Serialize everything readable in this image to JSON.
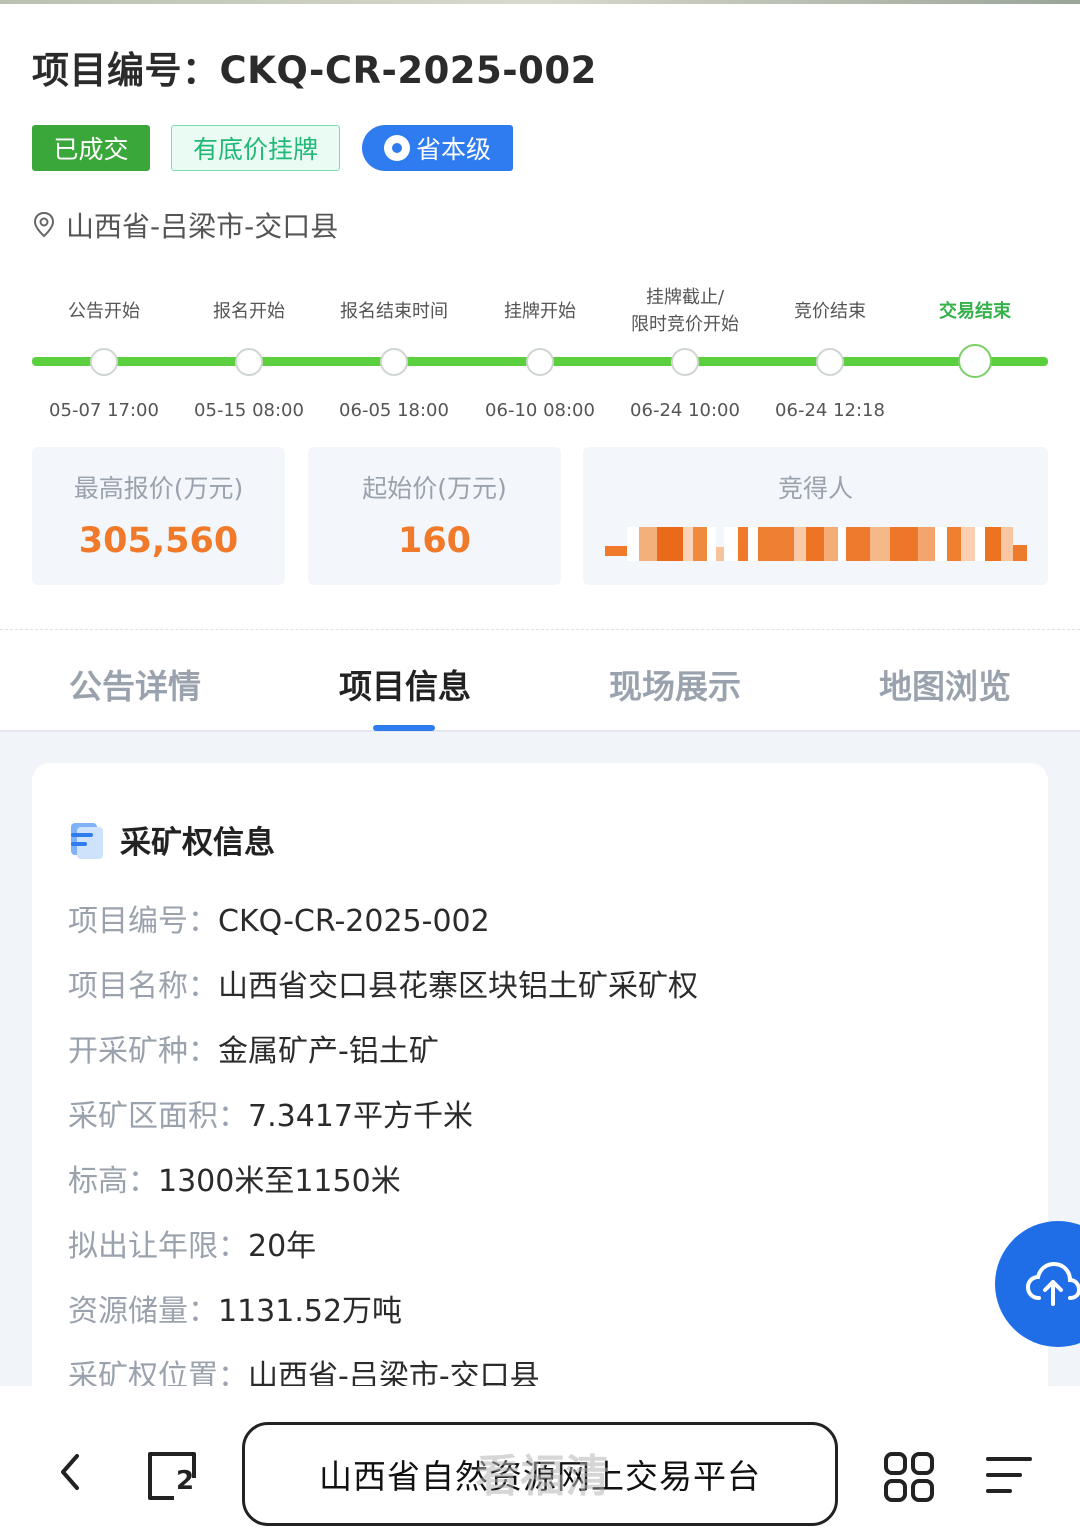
{
  "header": {
    "title_prefix": "项目编号：",
    "project_code": "CKQ-CR-2025-002",
    "tags": {
      "status": "已成交",
      "listing_type": "有底价挂牌",
      "level": "省本级"
    },
    "location": "山西省-吕梁市-交口县"
  },
  "timeline": {
    "steps": [
      {
        "label": "公告开始",
        "date": "05-07 17:00"
      },
      {
        "label": "报名开始",
        "date": "05-15 08:00"
      },
      {
        "label": "报名结束时间",
        "date": "06-05 18:00"
      },
      {
        "label": "挂牌开始",
        "date": "06-10 08:00"
      },
      {
        "label": "挂牌截止/",
        "label2": "限时竞价开始",
        "date": "06-24 10:00"
      },
      {
        "label": "竞价结束",
        "date": "06-24 12:18"
      },
      {
        "label": "交易结束",
        "date": ""
      }
    ],
    "colors": {
      "bar": "#5ccf3f",
      "active_label": "#35b14a"
    }
  },
  "summary": {
    "highest_bid_label": "最高报价(万元)",
    "highest_bid_value": "305,560",
    "start_price_label": "起始价(万元)",
    "start_price_value": "160",
    "winner_label": "竞得人"
  },
  "tabs": [
    {
      "label": "公告详情"
    },
    {
      "label": "项目信息"
    },
    {
      "label": "现场展示"
    },
    {
      "label": "地图浏览"
    }
  ],
  "active_tab": "项目信息",
  "panel": {
    "title": "采矿权信息",
    "rows": [
      {
        "key": "项目编号：",
        "value": "CKQ-CR-2025-002"
      },
      {
        "key": "项目名称：",
        "value": "山西省交口县花寨区块铝土矿采矿权"
      },
      {
        "key": "开采矿种：",
        "value": "金属矿产-铝土矿"
      },
      {
        "key": "采矿区面积：",
        "value": "7.3417平方千米"
      },
      {
        "key": "标高：",
        "value": "1300米至1150米"
      },
      {
        "key": "拟出让年限：",
        "value": "20年"
      },
      {
        "key": "资源储量：",
        "value": "1131.52万吨"
      },
      {
        "key": "采矿权位置：",
        "value": "山西省-吕梁市-交口县"
      }
    ]
  },
  "browser": {
    "page_title": "山西省自然资源网上交易平台",
    "tab_count": "2",
    "watermark": "看福清"
  },
  "icons": {
    "location": "location-pin-icon",
    "level_tag": "location-dot-icon",
    "panel": "document-icon",
    "fab": "cloud-upload-icon",
    "back": "back-arrow-icon",
    "tabs": "tabs-icon",
    "apps": "apps-grid-icon",
    "menu": "menu-icon"
  },
  "colors": {
    "accent_blue": "#2f7bf0",
    "success_green": "#3aa73a",
    "price_orange": "#f07a2a",
    "muted_text": "#9aa2ad"
  }
}
